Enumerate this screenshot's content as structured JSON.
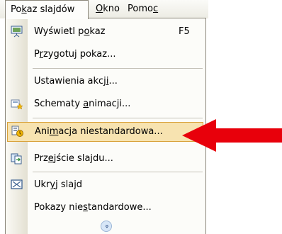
{
  "menubar": {
    "items": [
      {
        "pre": "Po",
        "ul": "k",
        "post": "az slajdów"
      },
      {
        "pre": "",
        "ul": "O",
        "post": "kno"
      },
      {
        "pre": "Pomo",
        "ul": "c",
        "post": ""
      }
    ]
  },
  "menu": {
    "items": [
      {
        "pre": "Wyświetl p",
        "ul": "o",
        "post": "kaz",
        "shortcut": "F5",
        "icon": "slideshow-icon"
      },
      {
        "pre": "P",
        "ul": "r",
        "post": "zygotuj pokaz..."
      },
      {
        "pre": "Ustawienia akcj",
        "ul": "i",
        "post": "..."
      },
      {
        "pre": "Schematy ",
        "ul": "a",
        "post": "nimacji...",
        "icon": "animation-schemes-icon"
      },
      {
        "pre": "Ani",
        "ul": "m",
        "post": "acja niestandardowa...",
        "icon": "custom-animation-icon"
      },
      {
        "pre": "Prz",
        "ul": "e",
        "post": "jście slajdu...",
        "icon": "slide-transition-icon"
      },
      {
        "pre": "Ukr",
        "ul": "y",
        "post": "j slajd",
        "icon": "hide-slide-icon"
      },
      {
        "pre": "Pokazy nie",
        "ul": "s",
        "post": "tandardowe..."
      }
    ],
    "expand_icon": "double-chevron-down-icon",
    "expand_glyph": "»"
  },
  "colors": {
    "highlight_bg": "#f7e3b0",
    "highlight_border": "#d9a23a",
    "arrow": "#e8000b",
    "menu_border": "#8a867a"
  },
  "annotation": {
    "icon": "red-arrow-icon"
  }
}
